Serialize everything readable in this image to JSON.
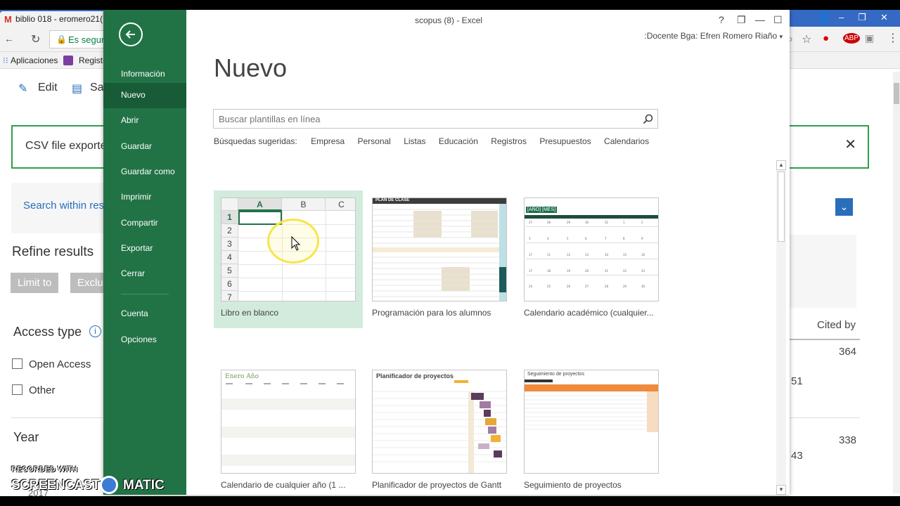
{
  "browser": {
    "tab_title": "biblio 018 - eromero21(",
    "address_text": "Es segur",
    "bookmarks": [
      "Aplicaciones",
      "Registr"
    ],
    "toolbar": [
      "Edit",
      "Sa"
    ]
  },
  "scopus_bg": {
    "csv_banner": "CSV file exported",
    "search_placeholder": "Search within res",
    "refine_title": "Refine results",
    "limit_to": "Limit to",
    "exclude": "Exclu",
    "access_type": "Access type",
    "open_access": "Open Access",
    "other": "Other",
    "year": "Year",
    "year_value": "2017",
    "cited_by": "Cited by",
    "cited_values": [
      "364",
      "51",
      "338",
      "43"
    ]
  },
  "excel": {
    "window_title": "scopus (8) - Excel",
    "user": ":Docente Bga: Efren Romero Riaño",
    "nav": [
      "Información",
      "Nuevo",
      "Abrir",
      "Guardar",
      "Guardar como",
      "Imprimir",
      "Compartir",
      "Exportar",
      "Cerrar",
      "Cuenta",
      "Opciones"
    ],
    "active_nav": "Nuevo",
    "heading": "Nuevo",
    "search_placeholder": "Buscar plantillas en línea",
    "suggested_label": "Búsquedas sugeridas:",
    "suggested": [
      "Empresa",
      "Personal",
      "Listas",
      "Educación",
      "Registros",
      "Presupuestos",
      "Calendarios"
    ],
    "templates": [
      {
        "caption": "Libro en blanco"
      },
      {
        "caption": "Programación para los alumnos",
        "thumb_title": "PLAN DE CLASE"
      },
      {
        "caption": "Calendario académico (cualquier...",
        "thumb_title": "[AÑO] [MES]"
      },
      {
        "caption": "Calendario de cualquier año (1 ...",
        "thumb_title": "Enero Año"
      },
      {
        "caption": "Planificador de proyectos de Gantt",
        "thumb_title": "Planificador de proyectos"
      },
      {
        "caption": "Seguimiento de proyectos",
        "thumb_title": "Seguimiento de proyectos"
      }
    ],
    "grid_cols": [
      "A",
      "B",
      "C"
    ],
    "grid_rows": [
      "1",
      "2",
      "3",
      "4",
      "5",
      "6",
      "7"
    ]
  },
  "watermark": {
    "recorded": "RECORDED WITH",
    "screencast": "SCREENCAST",
    "matic": "MATIC"
  },
  "colors": {
    "excel_green": "#217346",
    "nav_active": "#185c37",
    "selected_tile": "#d2ebdd",
    "banner_border": "#2e9e4c"
  }
}
